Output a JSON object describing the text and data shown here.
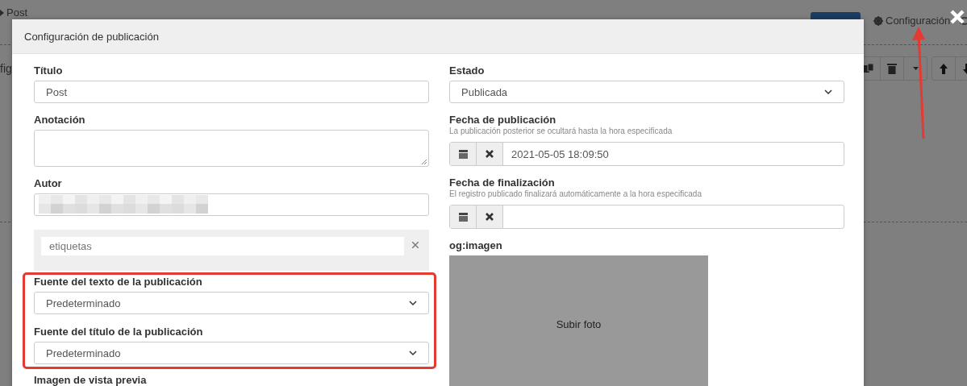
{
  "background_page": {
    "breadcrumb": "Post",
    "side_text": "fig",
    "settings_link": "Configuración"
  },
  "dialog": {
    "title": "Configuración de publicación",
    "left": [
      {
        "kind": "text",
        "label": "Título",
        "value": "Post"
      },
      {
        "kind": "textarea",
        "label": "Anotación"
      },
      {
        "kind": "blurred",
        "label": "Autor"
      },
      {
        "kind": "tags",
        "placeholder": "etiquetas"
      },
      {
        "kind": "select",
        "label": "Fuente del texto de la publicación",
        "value": "Predeterminado",
        "highlighted": true
      },
      {
        "kind": "select",
        "label": "Fuente del título de la publicación",
        "value": "Predeterminado",
        "highlighted": true
      },
      {
        "kind": "heading",
        "label": "Imagen de vista previa"
      }
    ],
    "right": [
      {
        "kind": "select",
        "label": "Estado",
        "value": "Publicada"
      },
      {
        "kind": "date",
        "label": "Fecha de publicación",
        "hint": "La publicación posterior se ocultará hasta la hora especificada",
        "value": "2021-05-05 18:09:50"
      },
      {
        "kind": "date",
        "label": "Fecha de finalización",
        "hint": "El registro publicado finalizará automáticamente a la hora especificada"
      },
      {
        "kind": "image",
        "label": "og:imagen",
        "button": "Subir foto"
      }
    ]
  }
}
